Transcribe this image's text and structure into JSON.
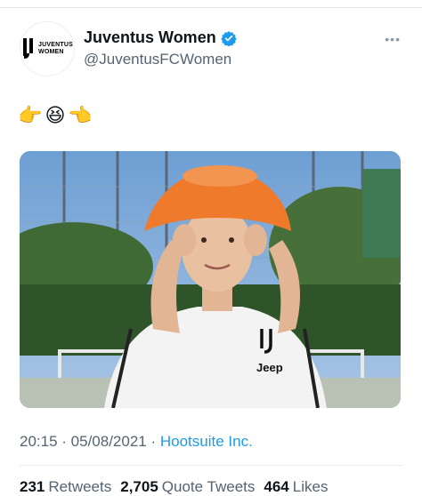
{
  "tweet": {
    "author": {
      "display_name": "Juventus Women",
      "handle": "@JuventusFCWomen",
      "avatar_text_line1": "JUVENTUS",
      "avatar_text_line2": "WOMEN",
      "verified": true
    },
    "text_emojis": [
      "👉",
      "😆",
      "👈"
    ],
    "time": "20:15",
    "date": "05/08/2021",
    "separator": " · ",
    "source": "Hootsuite Inc.",
    "stats": {
      "retweets_count": "231",
      "retweets_label": "Retweets",
      "quotes_count": "2,705",
      "quotes_label": "Quote Tweets",
      "likes_count": "464",
      "likes_label": "Likes"
    },
    "photo": {
      "shirt_sponsor": "Jeep"
    }
  },
  "colors": {
    "link": "#1d9bf0",
    "secondary_text": "#536471",
    "verified": "#1d9bf0",
    "cone": "#f07a2c"
  },
  "icons": {
    "verified": "verified-badge-icon",
    "more": "more-options-icon"
  }
}
